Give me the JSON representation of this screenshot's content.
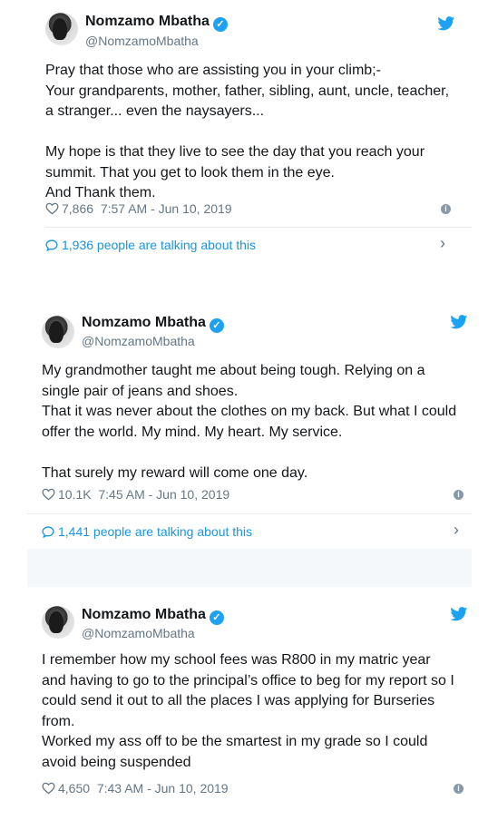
{
  "tweets": [
    {
      "name": "Nomzamo Mbatha",
      "handle": "@NomzamoMbatha",
      "text": "Pray that those who are assisting you in your climb;-\nYour grandparents, mother, father, sibling, aunt, uncle, teacher,\na stranger... even the naysayers...\n\nMy hope is that they live to see the day that you reach your\nsummit. That you get to look them in the eye.\nAnd Thank them.",
      "likes": "7,866",
      "timestamp": "7:57 AM - Jun 10, 2019",
      "talking": "1,936 people are talking about this"
    },
    {
      "name": "Nomzamo Mbatha",
      "handle": "@NomzamoMbatha",
      "text": "My grandmother taught me about being tough. Relying on a\nsingle pair of jeans and shoes.\nThat it was never about the clothes on my back. But what I could\noffer the world. My mind. My heart. My service.\n\nThat surely my reward will come one day.",
      "likes": "10.1K",
      "timestamp": "7:45 AM - Jun 10, 2019",
      "talking": "1,441 people are talking about this"
    },
    {
      "name": "Nomzamo Mbatha",
      "handle": "@NomzamoMbatha",
      "text": "I remember how my school fees was R800 in my matric year\nand having to go to the principal’s office to beg for my report so I\ncould send it out to all the places I was applying for Burseries\nfrom.\nWorked my ass off to be the smartest in my grade so I could\navoid being suspended",
      "likes": "4,650",
      "timestamp": "7:43 AM - Jun 10, 2019"
    }
  ],
  "icons": {
    "verified": "verified-badge-icon",
    "bird": "twitter-bird-icon",
    "heart": "heart-icon",
    "info": "info-icon",
    "bubble": "speech-bubble-icon",
    "chevron": "chevron-right-icon"
  },
  "colors": {
    "accent": "#1da1f2",
    "link": "#1b95e0",
    "muted": "#657786",
    "gap": "#f5f8fa"
  }
}
